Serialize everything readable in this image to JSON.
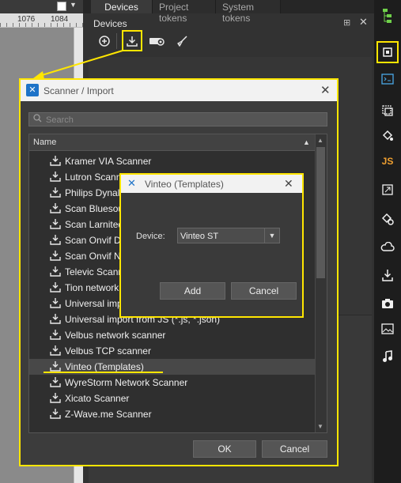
{
  "canvas": {
    "ruler_labels": [
      "1076",
      "1084"
    ]
  },
  "panel": {
    "tabs": [
      {
        "label": "Devices",
        "active": true
      },
      {
        "label": "Project tokens",
        "active": false
      },
      {
        "label": "System tokens",
        "active": false
      }
    ],
    "title": "Devices",
    "toolbar_icons": [
      "add-circle-icon",
      "import-icon",
      "projector-icon",
      "broom-icon"
    ]
  },
  "right_toolbar": {
    "items": [
      "tree-icon",
      "chip-icon",
      "terminal-icon",
      "layers-icon",
      "bucket-icon",
      "JS",
      "resize-icon",
      "bucket-gear-icon",
      "cloud-icon",
      "download-icon",
      "camera-icon",
      "image-icon",
      "music-icon"
    ],
    "js_label": "JS"
  },
  "scanner_dialog": {
    "title": "Scanner / Import",
    "search_placeholder": "Search",
    "column_header": "Name",
    "items": [
      "Kramer VIA Scanner",
      "Lutron Scann",
      "Philips Dynal",
      "Scan Bluesou",
      "Scan Larnited",
      "Scan Onvif D",
      "Scan Onvif N",
      "Televic Scann",
      "Tion network",
      "Universal impo",
      "Universal import from JS (*.js, *.json)",
      "Velbus network scanner",
      "Velbus TCP scanner",
      "Vinteo (Templates)",
      "WyreStorm Network Scanner",
      "Xicato Scanner",
      "Z-Wave.me Scanner"
    ],
    "selected_item": "Vinteo (Templates)",
    "ok_label": "OK",
    "cancel_label": "Cancel"
  },
  "vinteo_dialog": {
    "title": "Vinteo (Templates)",
    "device_label": "Device:",
    "device_value": "Vinteo ST",
    "add_label": "Add",
    "cancel_label": "Cancel"
  },
  "colors": {
    "highlight": "#ffe600",
    "dialog_bg": "#3a3a3a",
    "titlebar_bg": "#f2f2f2",
    "accent_blue": "#1e73c8"
  }
}
